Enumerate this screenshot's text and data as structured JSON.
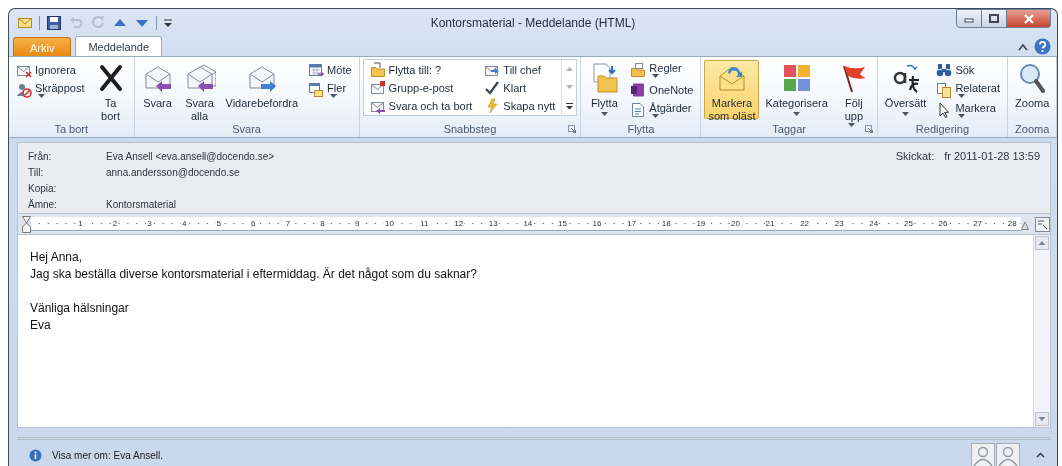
{
  "window": {
    "title": "Kontorsmaterial - Meddelande (HTML)"
  },
  "tabs": [
    {
      "label": "Arkiv",
      "kind": "file",
      "selected": false
    },
    {
      "label": "Meddelande",
      "kind": "ribbon",
      "selected": true
    }
  ],
  "ribbon": {
    "groups": [
      {
        "label": "Ta bort",
        "kind": "buttons",
        "launcher": false,
        "columns": [
          [
            {
              "kind": "small",
              "label": "Ignorera",
              "dropdown": false,
              "active": false
            },
            {
              "kind": "small",
              "label": "Skräppost",
              "dropdown": true,
              "active": false
            }
          ],
          [
            {
              "kind": "large",
              "lines": [
                "Ta",
                "bort"
              ],
              "dropdown": false,
              "active": false
            }
          ]
        ]
      },
      {
        "label": "Svara",
        "kind": "buttons",
        "launcher": false,
        "columns": [
          [
            {
              "kind": "large",
              "lines": [
                "Svara"
              ],
              "dropdown": false,
              "active": false
            }
          ],
          [
            {
              "kind": "large",
              "lines": [
                "Svara",
                "alla"
              ],
              "dropdown": false,
              "active": false
            }
          ],
          [
            {
              "kind": "large",
              "lines": [
                "Vidarebefordra"
              ],
              "dropdown": false,
              "active": false
            }
          ],
          [
            {
              "kind": "small",
              "label": "Möte",
              "dropdown": false,
              "active": false
            },
            {
              "kind": "small",
              "label": "Fler",
              "dropdown": true,
              "active": false
            }
          ]
        ]
      },
      {
        "label": "Snabbsteg",
        "kind": "gallery",
        "launcher": true,
        "columns": [
          [
            {
              "kind": "small",
              "label": "Flytta till: ?",
              "dropdown": false,
              "active": false
            },
            {
              "kind": "small",
              "label": "Grupp-e-post",
              "dropdown": false,
              "active": false
            },
            {
              "kind": "small",
              "label": "Svara och ta bort",
              "dropdown": false,
              "active": false
            }
          ],
          [
            {
              "kind": "small",
              "label": "Till chef",
              "dropdown": false,
              "active": false
            },
            {
              "kind": "small",
              "label": "Klart",
              "dropdown": false,
              "active": false
            },
            {
              "kind": "small",
              "label": "Skapa nytt",
              "dropdown": false,
              "active": false
            }
          ]
        ]
      },
      {
        "label": "Flytta",
        "kind": "buttons",
        "launcher": false,
        "columns": [
          [
            {
              "kind": "large",
              "lines": [
                "Flytta"
              ],
              "dropdown": true,
              "active": false
            }
          ],
          [
            {
              "kind": "small",
              "label": "Regler",
              "dropdown": true,
              "active": false
            },
            {
              "kind": "small",
              "label": "OneNote",
              "dropdown": false,
              "active": false
            },
            {
              "kind": "small",
              "label": "Åtgärder",
              "dropdown": true,
              "active": false
            }
          ]
        ]
      },
      {
        "label": "Taggar",
        "kind": "buttons",
        "launcher": true,
        "columns": [
          [
            {
              "kind": "large",
              "lines": [
                "Markera",
                "som oläst"
              ],
              "dropdown": false,
              "active": true
            }
          ],
          [
            {
              "kind": "large",
              "lines": [
                "Kategorisera"
              ],
              "dropdown": true,
              "active": false
            }
          ],
          [
            {
              "kind": "large",
              "lines": [
                "Följ",
                "upp"
              ],
              "dropdown": true,
              "active": false
            }
          ]
        ]
      },
      {
        "label": "Redigering",
        "kind": "buttons",
        "launcher": false,
        "columns": [
          [
            {
              "kind": "large",
              "lines": [
                "Översätt"
              ],
              "dropdown": true,
              "active": false
            }
          ],
          [
            {
              "kind": "small",
              "label": "Sök",
              "dropdown": false,
              "active": false
            },
            {
              "kind": "small",
              "label": "Relaterat",
              "dropdown": true,
              "active": false
            },
            {
              "kind": "small",
              "label": "Markera",
              "dropdown": true,
              "active": false
            }
          ]
        ]
      },
      {
        "label": "Zooma",
        "kind": "buttons",
        "launcher": false,
        "columns": [
          [
            {
              "kind": "large",
              "lines": [
                "Zooma"
              ],
              "dropdown": false,
              "active": false
            }
          ]
        ]
      }
    ]
  },
  "header": {
    "fields": [
      {
        "label": "Från:",
        "value": "Eva Ansell <eva.ansell@docendo.se>"
      },
      {
        "label": "Till:",
        "value": "anna.andersson@docendo.se"
      },
      {
        "label": "Kopia:"
      },
      {
        "label": "Ämne:",
        "value": "Kontorsmaterial"
      }
    ],
    "sent": {
      "label": "Skickat:",
      "value": "fr 2011-01-28 13:59"
    }
  },
  "ruler": {
    "numbers": [
      "1",
      "2",
      "3",
      "4",
      "5",
      "6",
      "7",
      "8",
      "9",
      "10",
      "11",
      "12",
      "13",
      "14",
      "15",
      "16",
      "17",
      "18",
      "19",
      "20",
      "21",
      "22",
      "23",
      "24",
      "25",
      "26",
      "27",
      "28"
    ]
  },
  "body": {
    "paragraphs": [
      [
        "Hej Anna,",
        "Jag ska beställa diverse kontorsmaterial i eftermiddag. Är det något som du saknar?"
      ],
      [
        "Vänliga hälsningar",
        "Eva"
      ]
    ]
  },
  "info_bar": {
    "text": "Visa mer om: Eva Ansell."
  }
}
